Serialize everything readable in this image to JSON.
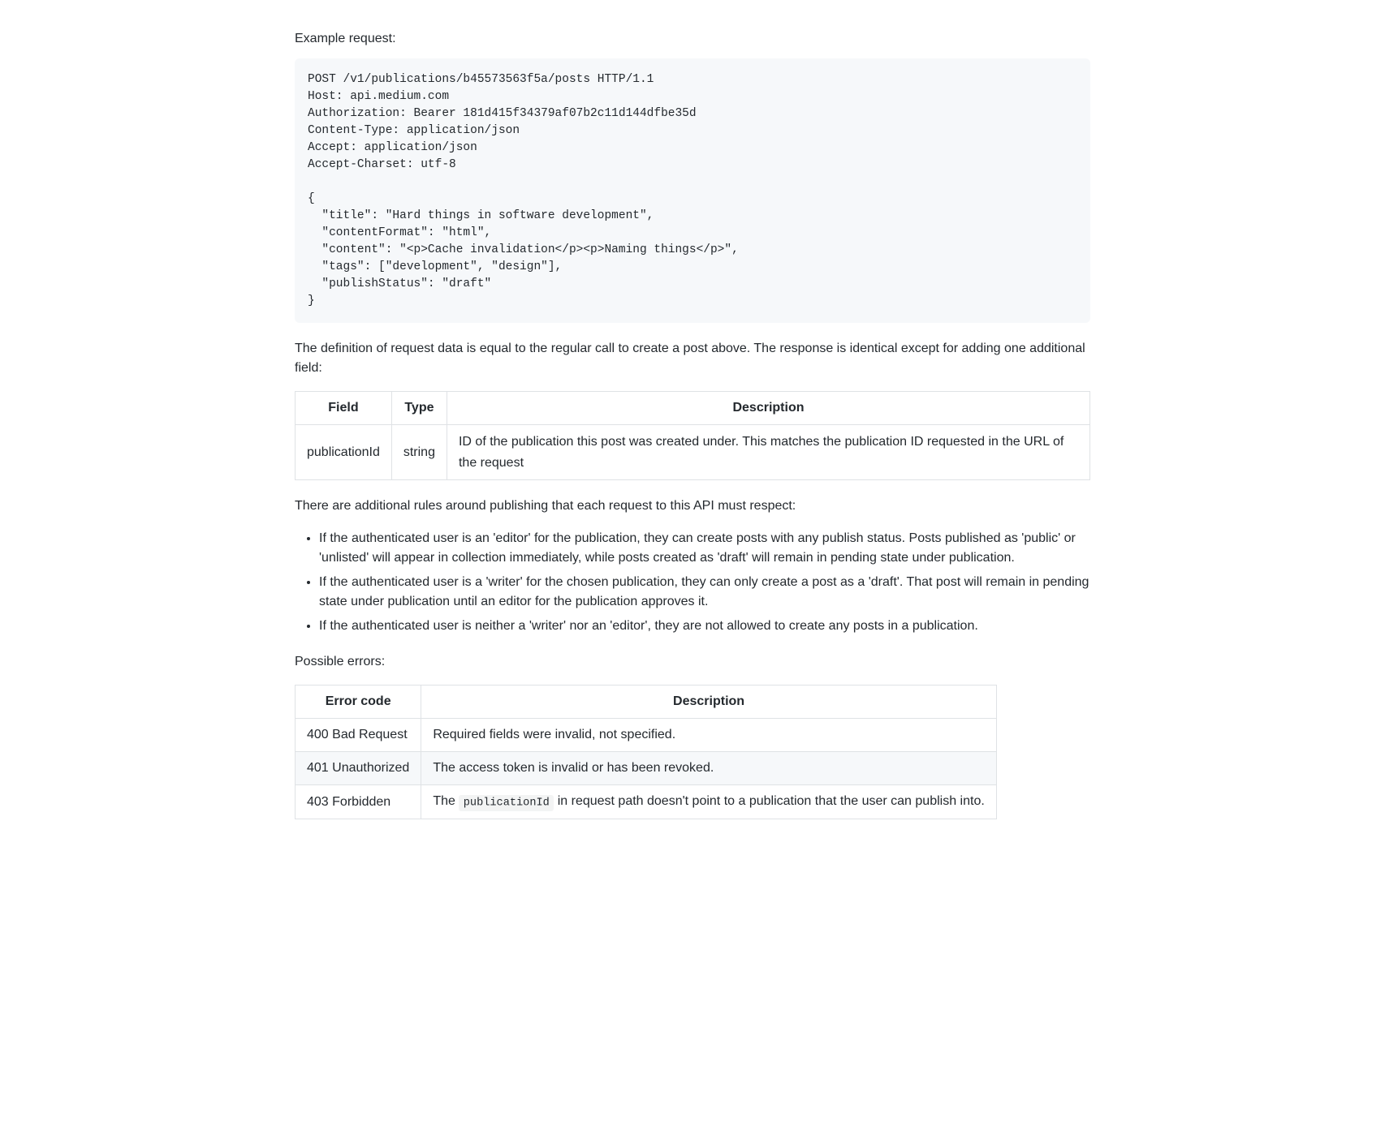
{
  "labels": {
    "example_request": "Example request:",
    "response_note": "The definition of request data is equal to the regular call to create a post above. The response is identical except for adding one additional field:",
    "rules_intro": "There are additional rules around publishing that each request to this API must respect:",
    "possible_errors": "Possible errors:"
  },
  "code_block": "POST /v1/publications/b45573563f5a/posts HTTP/1.1\nHost: api.medium.com\nAuthorization: Bearer 181d415f34379af07b2c11d144dfbe35d\nContent-Type: application/json\nAccept: application/json\nAccept-Charset: utf-8\n\n{\n  \"title\": \"Hard things in software development\",\n  \"contentFormat\": \"html\",\n  \"content\": \"<p>Cache invalidation</p><p>Naming things</p>\",\n  \"tags\": [\"development\", \"design\"],\n  \"publishStatus\": \"draft\"\n}",
  "field_table": {
    "headers": {
      "field": "Field",
      "type": "Type",
      "description": "Description"
    },
    "row": {
      "field": "publicationId",
      "type": "string",
      "description": "ID of the publication this post was created under. This matches the publication ID requested in the URL of the request"
    }
  },
  "rules": [
    "If the authenticated user is an 'editor' for the publication, they can create posts with any publish status. Posts published as 'public' or 'unlisted' will appear in collection immediately, while posts created as 'draft' will remain in pending state under publication.",
    "If the authenticated user is a 'writer' for the chosen publication, they can only create a post as a 'draft'. That post will remain in pending state under publication until an editor for the publication approves it.",
    "If the authenticated user is neither a 'writer' nor an 'editor', they are not allowed to create any posts in a publication."
  ],
  "error_table": {
    "headers": {
      "code": "Error code",
      "description": "Description"
    },
    "rows": [
      {
        "code": "400 Bad Request",
        "description": "Required fields were invalid, not specified."
      },
      {
        "code": "401 Unauthorized",
        "description": "The access token is invalid or has been revoked."
      },
      {
        "code": "403 Forbidden",
        "description_pre": "The ",
        "description_code": "publicationId",
        "description_post": " in request path doesn't point to a publication that the user can publish into."
      }
    ]
  }
}
